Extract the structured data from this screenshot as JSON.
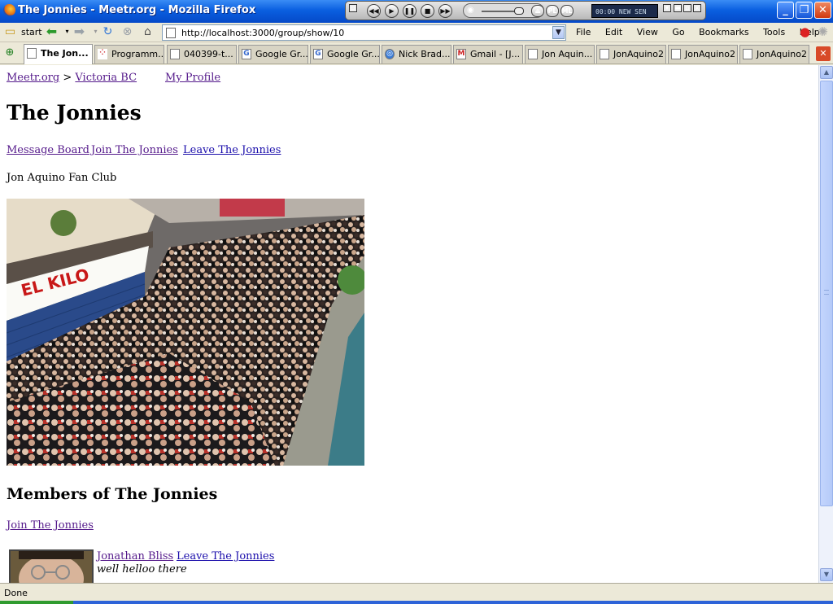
{
  "window": {
    "title": "The Jonnies - Meetr.org - Mozilla Firefox",
    "minimize": "_",
    "restore": "❐",
    "close": "✕"
  },
  "media_player": {
    "lcd_text": "00:00  NEW SEN",
    "pl_label": "PL",
    "ml_label": "ML"
  },
  "navbar": {
    "start_label": "start",
    "url": "http://localhost:3000/group/show/10",
    "menus": [
      "File",
      "Edit",
      "View",
      "Go",
      "Bookmarks",
      "Tools",
      "Help"
    ]
  },
  "tabs": [
    {
      "label": "The Jon...",
      "icon": "page-icon",
      "active": true
    },
    {
      "label": "Programm...",
      "icon": "dots-icon"
    },
    {
      "label": "040399-t...",
      "icon": "page-icon"
    },
    {
      "label": "Google Gr...",
      "icon": "google-icon"
    },
    {
      "label": "Google Gr...",
      "icon": "google-icon"
    },
    {
      "label": "Nick Brad...",
      "icon": "globe-icon"
    },
    {
      "label": "Gmail - [J...",
      "icon": "gmail-icon"
    },
    {
      "label": "Jon Aquin...",
      "icon": "page-icon"
    },
    {
      "label": "JonAquino2",
      "icon": "page-icon"
    },
    {
      "label": "JonAquino2",
      "icon": "page-icon"
    },
    {
      "label": "JonAquino2",
      "icon": "page-icon"
    }
  ],
  "page": {
    "breadcrumb": {
      "site": "Meetr.org",
      "separator": ">",
      "city": "Victoria BC"
    },
    "my_profile": "My Profile",
    "group_title": "The Jonnies",
    "actions": {
      "message_board": "Message Board",
      "join": "Join The Jonnies",
      "leave": "Leave The Jonnies"
    },
    "description": "Jon Aquino Fan Club",
    "photo_sign": "EL KILO",
    "members_heading": "Members of The Jonnies",
    "members_join": "Join The Jonnies",
    "members": [
      {
        "name": "Jonathan Bliss",
        "leave_label": "Leave The Jonnies",
        "status": "well helloo there"
      }
    ]
  },
  "status_bar": {
    "text": "Done"
  },
  "colors": {
    "link_visited": "#551a8b",
    "link": "#1a0dab",
    "titlebar": "#0a5fe0"
  }
}
